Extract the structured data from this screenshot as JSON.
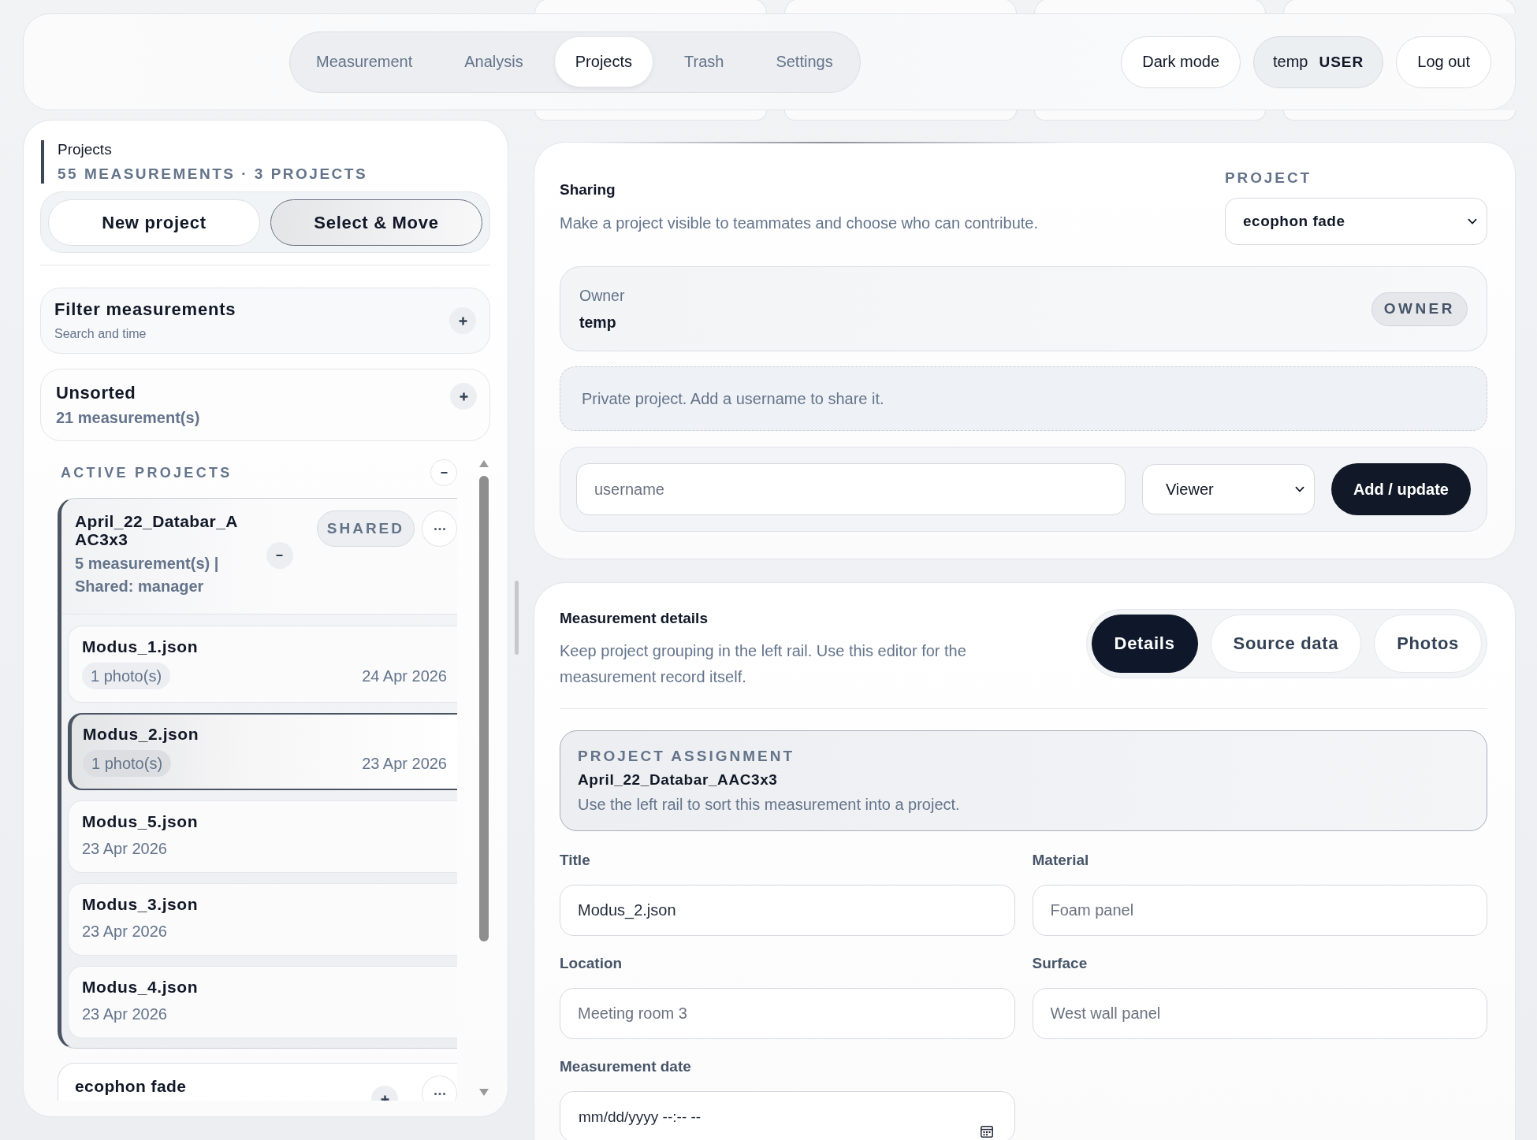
{
  "top_nav": {
    "tabs": [
      {
        "label": "Measurement",
        "selected": false
      },
      {
        "label": "Analysis",
        "selected": false
      },
      {
        "label": "Projects",
        "selected": true
      },
      {
        "label": "Trash",
        "selected": false
      },
      {
        "label": "Settings",
        "selected": false
      }
    ],
    "dark_mode_button": "Dark mode",
    "user": {
      "name": "temp",
      "role": "USER"
    },
    "logout_button": "Log out"
  },
  "sidebar": {
    "title": "Projects",
    "summary": "55 MEASUREMENTS · 3 PROJECTS",
    "actions": [
      {
        "label": "New project",
        "selected": false
      },
      {
        "label": "Select & Move",
        "selected": true
      }
    ],
    "filter": {
      "title": "Filter measurements",
      "subtitle": "Search and time",
      "expanded": false
    },
    "unsorted": {
      "title": "Unsorted",
      "count": "21 measurement(s)",
      "expanded": false
    },
    "active_projects": {
      "heading": "ACTIVE PROJECTS",
      "expanded": true,
      "projects": [
        {
          "name": "April_22_Databar_AAC3x3",
          "meta": "5 measurement(s) | Shared: manager",
          "badge": "SHARED",
          "expanded": true,
          "measurements": [
            {
              "name": "Modus_1.json",
              "photos": "1 photo(s)",
              "date": "24 Apr 2026",
              "selected": false
            },
            {
              "name": "Modus_2.json",
              "photos": "1 photo(s)",
              "date": "23 Apr 2026",
              "selected": true
            },
            {
              "name": "Modus_5.json",
              "date": "23 Apr 2026",
              "selected": false
            },
            {
              "name": "Modus_3.json",
              "date": "23 Apr 2026",
              "selected": false
            },
            {
              "name": "Modus_4.json",
              "date": "23 Apr 2026",
              "selected": false
            }
          ]
        },
        {
          "name": "ecophon fade",
          "expanded": false
        }
      ]
    }
  },
  "sharing": {
    "title": "Sharing",
    "description": "Make a project visible to teammates and choose who can contribute.",
    "project_label": "PROJECT",
    "project_select": "ecophon fade",
    "owner": {
      "label": "Owner",
      "name": "temp",
      "badge": "OWNER"
    },
    "notice": "Private project. Add a username to share it.",
    "username_field": {
      "placeholder": "username"
    },
    "role_select": "Viewer",
    "submit_button": "Add / update"
  },
  "measurement_details": {
    "title": "Measurement details",
    "description": "Keep project grouping in the left rail. Use this editor for the measurement record itself.",
    "tabs": [
      {
        "label": "Details",
        "selected": true
      },
      {
        "label": "Source data",
        "selected": false
      },
      {
        "label": "Photos",
        "selected": false
      }
    ],
    "assignment": {
      "heading": "PROJECT ASSIGNMENT",
      "project": "April_22_Databar_AAC3x3",
      "hint": "Use the left rail to sort this measurement into a project."
    },
    "fields": [
      {
        "kind": "text",
        "label": "Title",
        "value": "Modus_2.json"
      },
      {
        "kind": "text",
        "label": "Material",
        "placeholder": "Foam panel"
      },
      {
        "kind": "text",
        "label": "Location",
        "placeholder": "Meeting room 3"
      },
      {
        "kind": "text",
        "label": "Surface",
        "placeholder": "West wall panel"
      },
      {
        "kind": "datetime",
        "label": "Measurement date",
        "placeholder": "mm/dd/yyyy --:-- --"
      }
    ]
  }
}
